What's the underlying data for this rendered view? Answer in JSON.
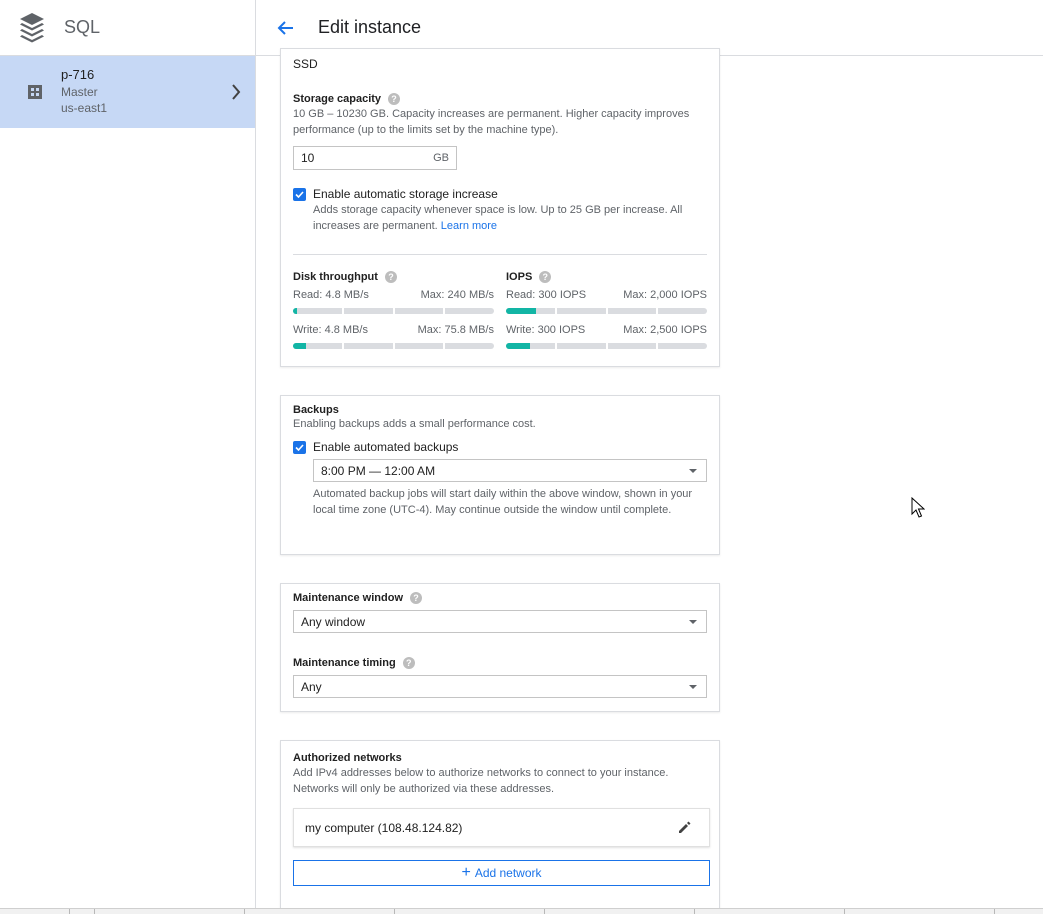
{
  "app": {
    "product_name": "SQL"
  },
  "header": {
    "title": "Edit instance"
  },
  "sidebar": {
    "instance": {
      "name": "p-716",
      "role": "Master",
      "region": "us-east1"
    }
  },
  "storage": {
    "type_value": "SSD",
    "capacity_label": "Storage capacity",
    "capacity_desc": "10 GB – 10230 GB. Capacity increases are permanent. Higher capacity improves performance (up to the limits set by the machine type).",
    "capacity_value": "10",
    "capacity_unit": "GB",
    "auto_increase_label": "Enable automatic storage increase",
    "auto_increase_checked": true,
    "auto_increase_desc": "Adds storage capacity whenever space is low. Up to 25 GB per increase. All increases are permanent.",
    "learn_more": "Learn more"
  },
  "performance": {
    "throughput_label": "Disk throughput",
    "throughput_read": "Read: 4.8 MB/s",
    "throughput_read_max": "Max: 240 MB/s",
    "throughput_read_fill": 0.02,
    "throughput_write": "Write: 4.8 MB/s",
    "throughput_write_max": "Max: 75.8 MB/s",
    "throughput_write_fill": 0.063,
    "iops_label": "IOPS",
    "iops_read": "Read: 300 IOPS",
    "iops_read_max": "Max: 2,000 IOPS",
    "iops_read_fill": 0.15,
    "iops_write": "Write: 300 IOPS",
    "iops_write_max": "Max: 2,500 IOPS",
    "iops_write_fill": 0.12
  },
  "backups": {
    "label": "Backups",
    "desc": "Enabling backups adds a small performance cost.",
    "enable_label": "Enable automated backups",
    "enable_checked": true,
    "window_value": "8:00 PM — 12:00 AM",
    "window_desc": "Automated backup jobs will start daily within the above window, shown in your local time zone (UTC-4). May continue outside the window until complete."
  },
  "maintenance": {
    "window_label": "Maintenance window",
    "window_value": "Any window",
    "timing_label": "Maintenance timing",
    "timing_value": "Any"
  },
  "networks": {
    "label": "Authorized networks",
    "desc": "Add IPv4 addresses below to authorize networks to connect to your instance. Networks will only be authorized via these addresses.",
    "items": [
      {
        "name": "my computer (108.48.124.82)"
      }
    ],
    "add_label": "Add network"
  },
  "icons": {
    "product": "sql-layers-icon",
    "instance": "instance-grid-icon",
    "chevron": "chevron-right-icon",
    "back": "arrow-back-icon",
    "help": "help-icon",
    "edit": "pencil-icon",
    "add": "plus-icon"
  },
  "colors": {
    "accent": "#1a73e8",
    "selected_bg": "#c6d8f5",
    "meter_fill": "#12b5a5"
  }
}
